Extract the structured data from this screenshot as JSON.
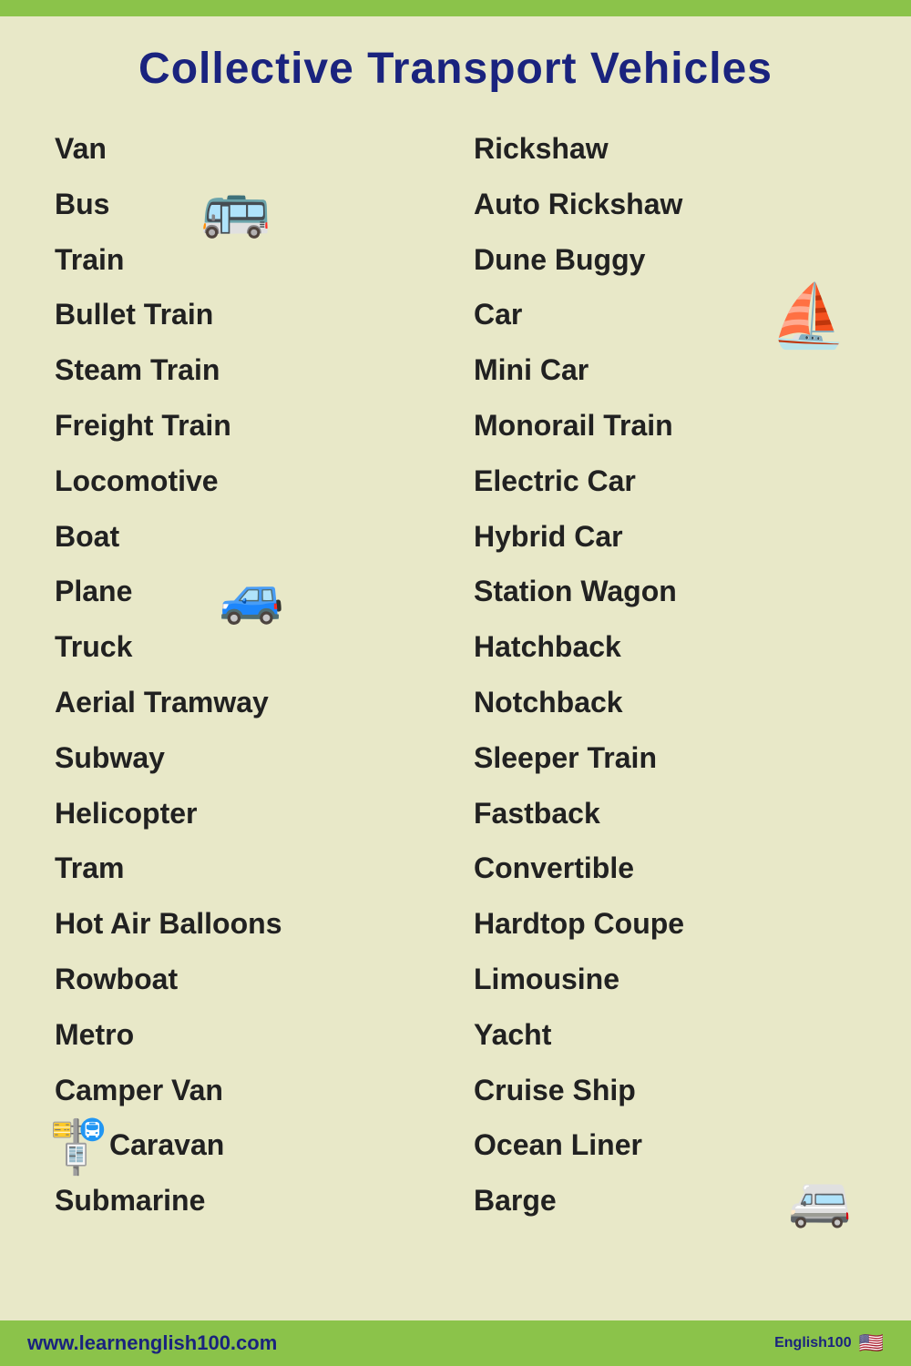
{
  "header": {
    "title": "Collective Transport Vehicles"
  },
  "left_column": [
    "Van",
    "Bus",
    "Train",
    "Bullet Train",
    "Steam Train",
    "Freight Train",
    "Locomotive",
    "Boat",
    "Plane",
    "Truck",
    "Aerial Tramway",
    "Subway",
    "Helicopter",
    "Tram",
    "Hot Air Balloons",
    "Rowboat",
    "Metro",
    "Camper Van",
    "Caravan",
    "Submarine"
  ],
  "right_column": [
    "Rickshaw",
    "Auto Rickshaw",
    "Dune Buggy",
    "Car",
    "Mini Car",
    "Monorail Train",
    "Electric Car",
    "Hybrid Car",
    "Station Wagon",
    "Hatchback",
    "Notchback",
    "Sleeper Train",
    "Fastback",
    "Convertible",
    "Hardtop Coupe",
    "Limousine",
    "Yacht",
    "Cruise Ship",
    "Ocean Liner",
    "Barge"
  ],
  "footer": {
    "url": "www.learnenglish100.com",
    "brand": "English100"
  }
}
